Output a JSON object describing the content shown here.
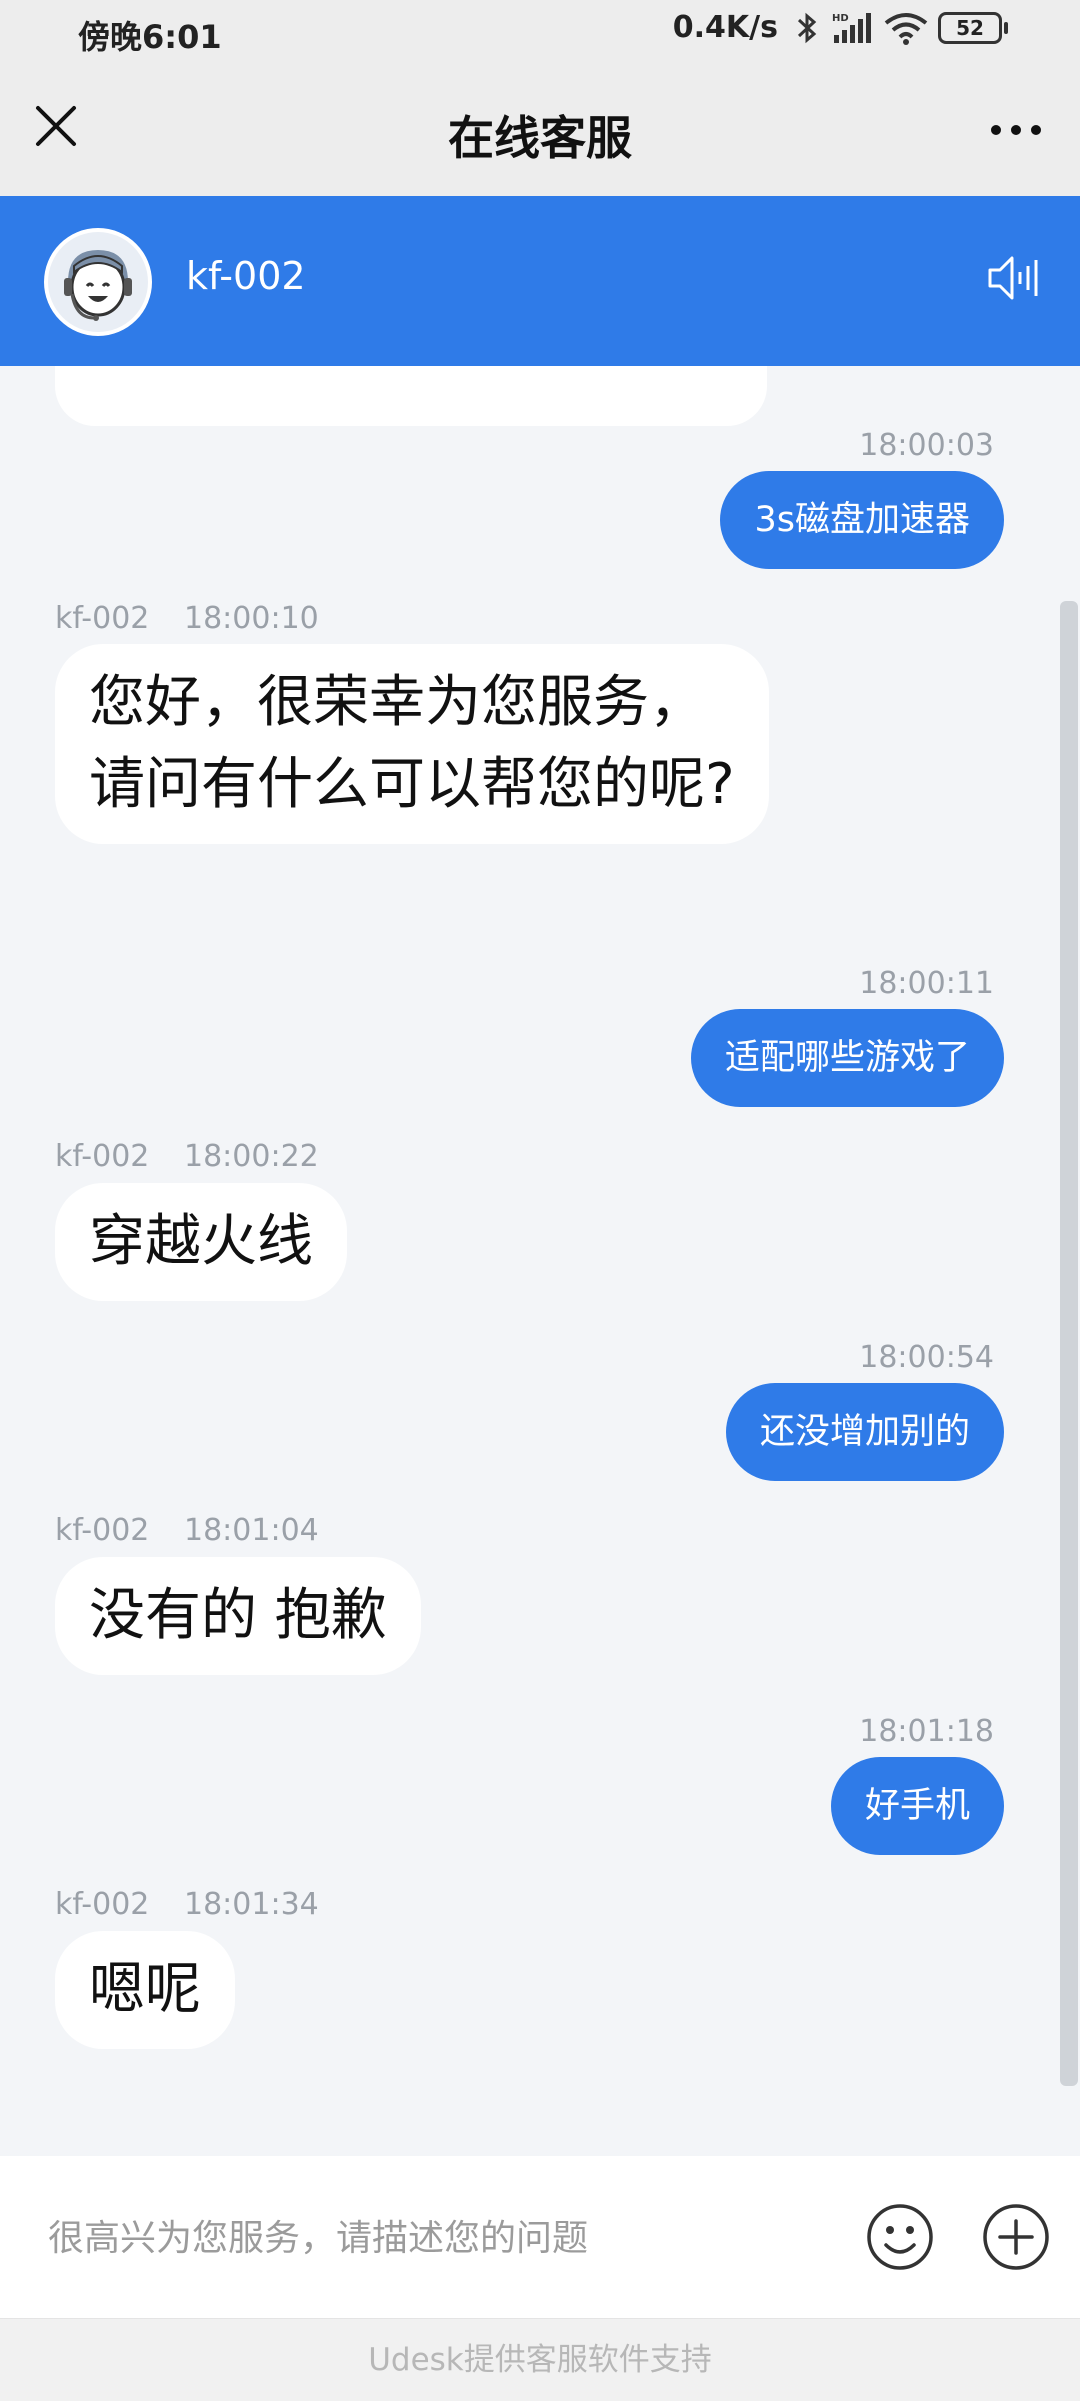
{
  "status_bar": {
    "time": "傍晚6:01",
    "net_speed": "0.4K/s",
    "battery": "52"
  },
  "nav": {
    "title": "在线客服"
  },
  "agent": {
    "name": "kf-002"
  },
  "messages": [
    {
      "side": "out",
      "time": "18:00:03",
      "text": "3s磁盘加速器"
    },
    {
      "side": "in",
      "sender": "kf-002",
      "time": "18:00:10",
      "text": "您好，很荣幸为您服务，请问有什么可以帮您的呢?"
    },
    {
      "side": "out",
      "time": "18:00:11",
      "text": "适配哪些游戏了"
    },
    {
      "side": "in",
      "sender": "kf-002",
      "time": "18:00:22",
      "text": "穿越火线"
    },
    {
      "side": "out",
      "time": "18:00:54",
      "text": "还没增加别的"
    },
    {
      "side": "in",
      "sender": "kf-002",
      "time": "18:01:04",
      "text": "没有的 抱歉"
    },
    {
      "side": "out",
      "time": "18:01:18",
      "text": "好手机"
    },
    {
      "side": "in",
      "sender": "kf-002",
      "time": "18:01:34",
      "text": "嗯呢"
    }
  ],
  "input": {
    "placeholder": "很高兴为您服务，请描述您的问题"
  },
  "footer": {
    "text": "Udesk提供客服软件支持"
  },
  "colors": {
    "accent": "#2f7be8",
    "chat_bg": "#f3f5f8"
  }
}
